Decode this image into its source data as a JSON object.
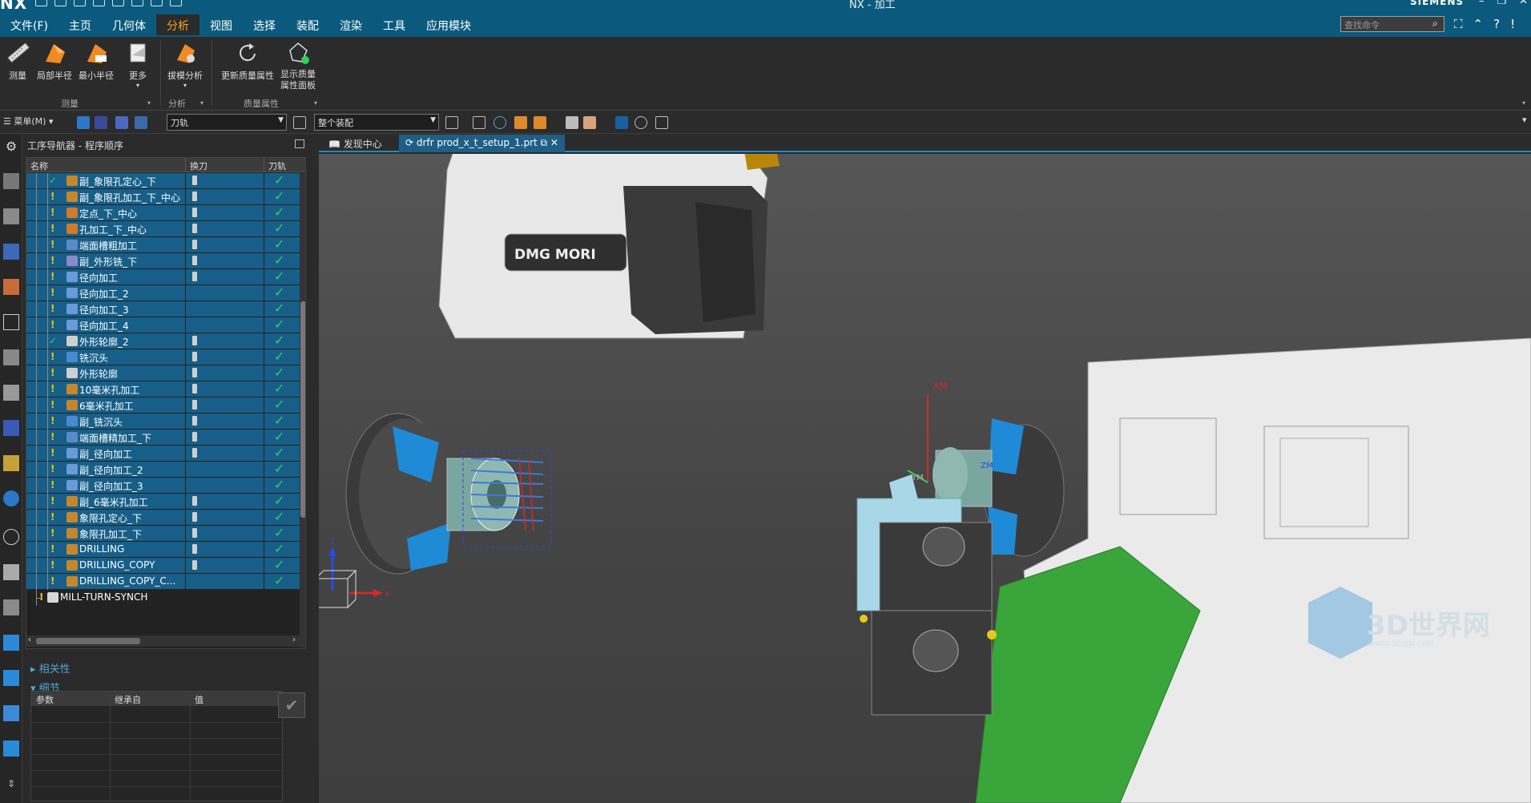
{
  "app": {
    "logo": "NX",
    "window_title": "NX - 加工",
    "brand": "SIEMENS",
    "window_controls": [
      "–",
      "❐",
      "✕"
    ]
  },
  "menubar": {
    "items": [
      "文件(F)",
      "主页",
      "几何体",
      "分析",
      "视图",
      "选择",
      "装配",
      "渲染",
      "工具",
      "应用模块"
    ],
    "active_index": 3
  },
  "command_search": {
    "placeholder": "查找命令"
  },
  "ribbon": {
    "buttons": [
      {
        "label": "测量",
        "icon": "measure-ruler-icon"
      },
      {
        "label": "局部半径",
        "icon": "local-radius-icon"
      },
      {
        "label": "最小半径",
        "icon": "min-radius-icon"
      },
      {
        "label": "更多",
        "icon": "more-icon"
      },
      {
        "label": "拔模分析",
        "icon": "draft-analysis-icon"
      },
      {
        "label": "更新质量属性",
        "icon": "refresh-icon"
      },
      {
        "label": "显示质量属性面板",
        "icon": "mass-properties-icon"
      }
    ],
    "groups": [
      "测量",
      "分析",
      "质量属性"
    ]
  },
  "toolbar": {
    "menu_label": "菜单(M)",
    "filter_combo": "刀轨",
    "scope_combo": "整个装配"
  },
  "navigator": {
    "title": "工序导航器 - 程序顺序",
    "columns": [
      "名称",
      "换刀",
      "刀轨"
    ],
    "rows": [
      {
        "label": "副_象限孔定心_下",
        "ok": true,
        "tool": true,
        "path": true,
        "sel": true,
        "icon": "drill-op-icon"
      },
      {
        "label": "副_象限孔加工_下_中心",
        "ok": false,
        "tool": true,
        "path": true,
        "sel": true,
        "icon": "drill-op-icon"
      },
      {
        "label": "定点_下_中心",
        "ok": false,
        "tool": true,
        "path": true,
        "sel": true,
        "icon": "spot-op-icon"
      },
      {
        "label": "孔加工_下_中心",
        "ok": false,
        "tool": true,
        "path": true,
        "sel": true,
        "icon": "spot-op-icon"
      },
      {
        "label": "端面槽粗加工",
        "ok": false,
        "tool": true,
        "path": true,
        "sel": true,
        "icon": "face-groove-icon"
      },
      {
        "label": "副_外形铣_下",
        "ok": false,
        "tool": true,
        "path": true,
        "sel": true,
        "icon": "profile-op-icon"
      },
      {
        "label": "径向加工",
        "ok": false,
        "tool": true,
        "path": true,
        "sel": true,
        "icon": "radial-op-icon"
      },
      {
        "label": "径向加工_2",
        "ok": false,
        "tool": false,
        "path": true,
        "sel": true,
        "icon": "radial-op-icon"
      },
      {
        "label": "径向加工_3",
        "ok": false,
        "tool": false,
        "path": true,
        "sel": true,
        "icon": "radial-op-icon"
      },
      {
        "label": "径向加工_4",
        "ok": false,
        "tool": false,
        "path": true,
        "sel": true,
        "icon": "radial-op-icon"
      },
      {
        "label": "外形轮廓_2",
        "ok": true,
        "tool": true,
        "path": true,
        "sel": true,
        "icon": "contour-op-icon"
      },
      {
        "label": "铣沉头",
        "ok": false,
        "tool": true,
        "path": true,
        "sel": true,
        "icon": "counterbore-op-icon"
      },
      {
        "label": "外形轮廓",
        "ok": false,
        "tool": true,
        "path": true,
        "sel": true,
        "icon": "contour-op-icon"
      },
      {
        "label": "10毫米孔加工",
        "ok": false,
        "tool": true,
        "path": true,
        "sel": true,
        "icon": "drill-op-icon"
      },
      {
        "label": "6毫米孔加工",
        "ok": false,
        "tool": true,
        "path": true,
        "sel": true,
        "icon": "drill-op-icon"
      },
      {
        "label": "副_铣沉头",
        "ok": false,
        "tool": true,
        "path": true,
        "sel": true,
        "icon": "counterbore-op-icon"
      },
      {
        "label": "端面槽精加工_下",
        "ok": false,
        "tool": true,
        "path": true,
        "sel": true,
        "icon": "face-groove-icon"
      },
      {
        "label": "副_径向加工",
        "ok": false,
        "tool": true,
        "path": true,
        "sel": true,
        "icon": "radial-op-icon"
      },
      {
        "label": "副_径向加工_2",
        "ok": false,
        "tool": false,
        "path": true,
        "sel": true,
        "icon": "radial-op-icon"
      },
      {
        "label": "副_径向加工_3",
        "ok": false,
        "tool": false,
        "path": true,
        "sel": true,
        "icon": "radial-op-icon"
      },
      {
        "label": "副_6毫米孔加工",
        "ok": false,
        "tool": true,
        "path": true,
        "sel": true,
        "icon": "drill-op-icon"
      },
      {
        "label": "象限孔定心_下",
        "ok": false,
        "tool": true,
        "path": true,
        "sel": true,
        "icon": "drill-op-icon"
      },
      {
        "label": "象限孔加工_下",
        "ok": false,
        "tool": true,
        "path": true,
        "sel": true,
        "icon": "drill-op-icon"
      },
      {
        "label": "DRILLING",
        "ok": false,
        "tool": true,
        "path": true,
        "sel": true,
        "icon": "drill-op-icon"
      },
      {
        "label": "DRILLING_COPY",
        "ok": false,
        "tool": true,
        "path": true,
        "sel": true,
        "icon": "drill-op-icon"
      },
      {
        "label": "DRILLING_COPY_C...",
        "ok": false,
        "tool": false,
        "path": true,
        "sel": true,
        "icon": "drill-op-icon"
      },
      {
        "label": "MILL-TURN-SYNCH",
        "ok": false,
        "tool": false,
        "path": false,
        "sel": false,
        "icon": "program-group-icon",
        "group": true
      }
    ]
  },
  "panels": {
    "dependencies": "相关性",
    "details": "细节",
    "detail_columns": [
      "参数",
      "继承自",
      "值"
    ]
  },
  "tabs": [
    {
      "label": "发现中心",
      "active": false
    },
    {
      "label": "drfr prod_x_t_setup_1.prt",
      "active": true
    }
  ],
  "viewport": {
    "machine_label": "DMG MORI",
    "axis_label_xm": "XM",
    "axis_label_ym": "YM",
    "axis_label_zm": "ZM",
    "triad_x": "X",
    "triad_z": "Z",
    "watermark": "3D世界网",
    "watermark_sub": "WWW.3DSJW.COM"
  },
  "colors": {
    "title_bar": "#0b5a7d",
    "accent_tab": "#f5a623",
    "selection": "#175f88",
    "ok_check": "#2fd05a",
    "flag_yellow": "#f5c400",
    "chuck_blue": "#1f8ad6",
    "turret_green": "#3aa53a"
  }
}
